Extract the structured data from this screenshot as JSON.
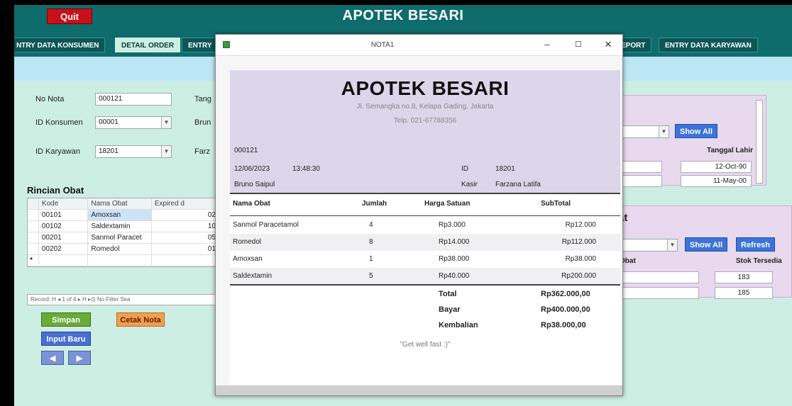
{
  "app": {
    "quit_label": "Quit",
    "title": "APOTEK BESARI",
    "tabs": [
      "NTRY DATA KONSUMEN",
      "DETAIL ORDER",
      "ENTRY",
      "EPORT",
      "ENTRY DATA KARYAWAN"
    ]
  },
  "form": {
    "no_nota_label": "No Nota",
    "no_nota_value": "000121",
    "id_konsumen_label": "ID Konsumen",
    "id_konsumen_value": "00001",
    "id_karyawan_label": "ID Karyawan",
    "id_karyawan_value": "18201",
    "partial_labels": [
      "Tang",
      "Brun",
      "Farz"
    ]
  },
  "subform": {
    "title": "Rincian Obat",
    "headers": [
      "Kode",
      "Nama Obat",
      "Expired d"
    ],
    "rows": [
      {
        "kode": "00101",
        "nama": "Amoxsan",
        "exp": "02"
      },
      {
        "kode": "00102",
        "nama": "Saldextamin",
        "exp": "10"
      },
      {
        "kode": "00201",
        "nama": "Sanmol Paracet",
        "exp": "05"
      },
      {
        "kode": "00202",
        "nama": "Romedol",
        "exp": "01"
      }
    ],
    "new_row_marker": "*",
    "record_nav": "Record: H  ◂ 1 of 4   ▸  H  ▸⊡   No Filter   Sea"
  },
  "buttons": {
    "simpan": "Simpan",
    "cetak": "Cetak Nota",
    "input_baru": "Input Baru",
    "prev": "◀",
    "next": "▶"
  },
  "right_panel_1": {
    "show_all": "Show All",
    "col_header": "Tanggal Lahir",
    "values": [
      "12-Oct-90",
      "11-May-00"
    ]
  },
  "right_panel_2": {
    "title_partial": "at",
    "show_all": "Show All",
    "refresh": "Refresh",
    "col_left": "Obat",
    "col_right": "Stok Tersedia",
    "values": [
      "183",
      "185"
    ]
  },
  "popup": {
    "title": "NOTA1",
    "minimize": "–",
    "maximize": "☐",
    "close": "✕",
    "receipt": {
      "store": "APOTEK BESARI",
      "address": "Jl. Semangka no.8, Kelapa Gading, Jakarta",
      "phone": "Telp. 021-67788356",
      "nota": "000121",
      "date": "12/06/2023",
      "time": "13:48:30",
      "id_label": "ID",
      "id_value": "18201",
      "customer": "Bruno Saipul",
      "kasir_label": "Kasir",
      "kasir_value": "Farzana Latifa",
      "headers": [
        "Nama Obat",
        "Jumlah",
        "Harga Satuan",
        "SubTotal"
      ],
      "items": [
        {
          "nama": "Sanmol Paracetamol",
          "jumlah": "4",
          "harga": "Rp3.000",
          "subtotal": "Rp12.000"
        },
        {
          "nama": "Romedol",
          "jumlah": "8",
          "harga": "Rp14.000",
          "subtotal": "Rp112.000"
        },
        {
          "nama": "Amoxsan",
          "jumlah": "1",
          "harga": "Rp38.000",
          "subtotal": "Rp38.000"
        },
        {
          "nama": "Saldextamin",
          "jumlah": "5",
          "harga": "Rp40.000",
          "subtotal": "Rp200.000"
        }
      ],
      "total_label": "Total",
      "total_value": "Rp362.000,00",
      "bayar_label": "Bayar",
      "bayar_value": "Rp400.000,00",
      "kembalian_label": "Kembalian",
      "kembalian_value": "Rp38.000,00",
      "footer": "\"Get well fast :)\""
    }
  }
}
